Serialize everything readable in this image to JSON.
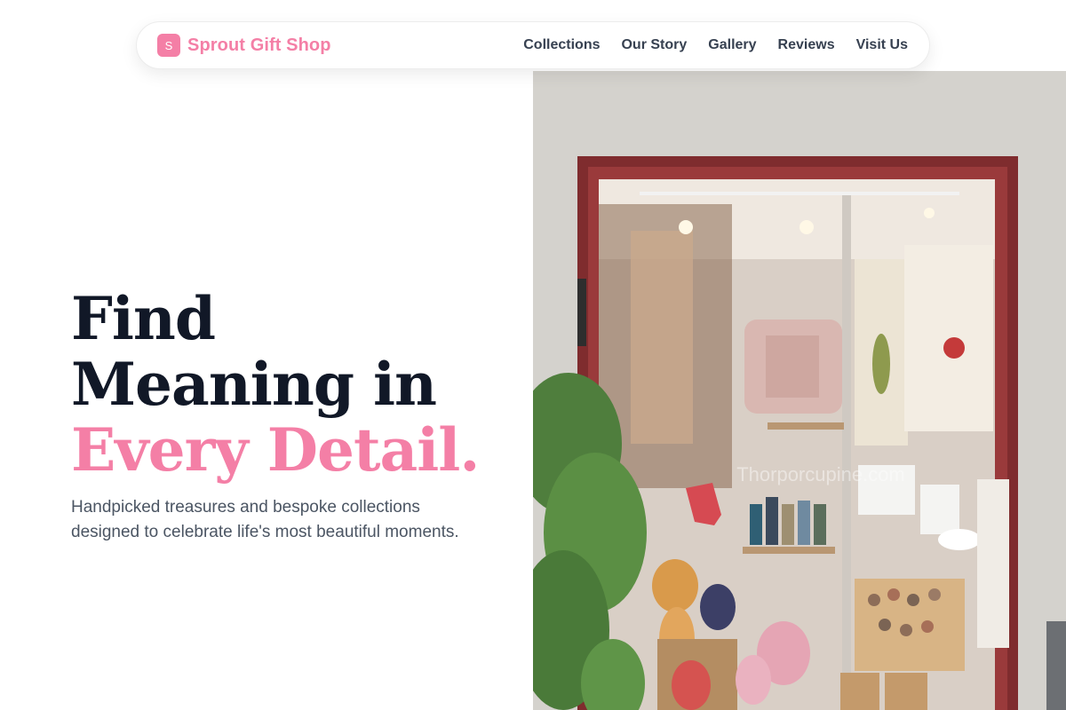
{
  "nav": {
    "brand_badge": "S",
    "brand_name": "Sprout Gift Shop",
    "links": [
      "Collections",
      "Our Story",
      "Gallery",
      "Reviews",
      "Visit Us"
    ]
  },
  "hero": {
    "headline_line1": "Find",
    "headline_line2": "Meaning in",
    "headline_accent": "Every Detail.",
    "subtext": "Handpicked treasures and bespoke collections designed to celebrate life's most beautiful moments."
  },
  "image": {
    "watermark": "Thorporcupine.com"
  },
  "colors": {
    "brand_pink": "#f47fa6",
    "heading": "#111827",
    "body_text": "#4b5563",
    "nav_text": "#374151",
    "window_frame": "#8b2f2f"
  }
}
